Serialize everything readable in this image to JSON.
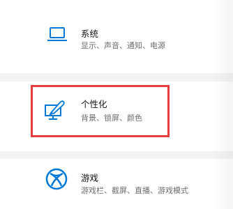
{
  "settings_tiles": [
    {
      "title": "系统",
      "description": "显示、声音、通知、电源",
      "icon": "laptop-icon"
    },
    {
      "title": "个性化",
      "description": "背景、锁屏、颜色",
      "icon": "personalization-icon"
    },
    {
      "title": "游戏",
      "description": "游戏栏、截屏、直播、游戏模式",
      "icon": "xbox-icon"
    }
  ],
  "colors": {
    "accent": "#0078d7",
    "highlight_border": "#e53c3c"
  }
}
